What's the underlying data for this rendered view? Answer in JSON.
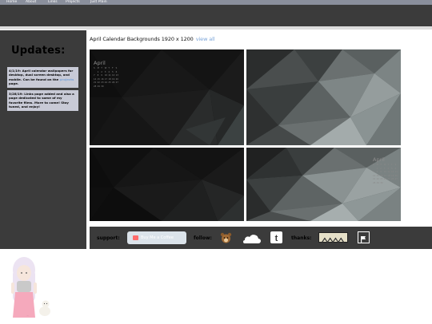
{
  "nav": {
    "items": [
      "Home",
      "About",
      "Links",
      "Projects",
      "Just Plain"
    ]
  },
  "sidebar": {
    "title": "Updates:",
    "updates": [
      {
        "text_before": "4/1/19: April calendar wallpapers for desktop, dual screen desktop, and mobile. Can be found on the ",
        "link": "projects",
        "text_after": " page."
      },
      {
        "text": "3/28/19: Links page added and also a page dedicated to some of my favorite films. More to come! Stay tuned, and enjoy!"
      }
    ]
  },
  "main": {
    "title": "April Calendar Backgrounds 1920 x 1200",
    "view_all": "view all"
  },
  "calendar": {
    "month": "April",
    "days": [
      "S",
      "M",
      "T",
      "W",
      "T",
      "F",
      "S"
    ],
    "dates": [
      "",
      "1",
      "2",
      "3",
      "4",
      "5",
      "6",
      "7",
      "8",
      "9",
      "10",
      "11",
      "12",
      "13",
      "14",
      "15",
      "16",
      "17",
      "18",
      "19",
      "20",
      "21",
      "22",
      "23",
      "24",
      "25",
      "26",
      "27",
      "28",
      "29",
      "30"
    ]
  },
  "footer": {
    "support_label": "support:",
    "coffee_label": "Buy Me a Coffee",
    "follow_label": "follow:",
    "thanks_label": "thanks:",
    "icons": [
      "bear-icon",
      "soundcloud-icon",
      "tumblr-icon",
      "badge-icon",
      "flag-icon"
    ]
  },
  "colors": {
    "nav": "#8a8f9c",
    "dark": "#3b3b3b",
    "update_box": "#c8cad6",
    "link": "#7aa4d8"
  }
}
